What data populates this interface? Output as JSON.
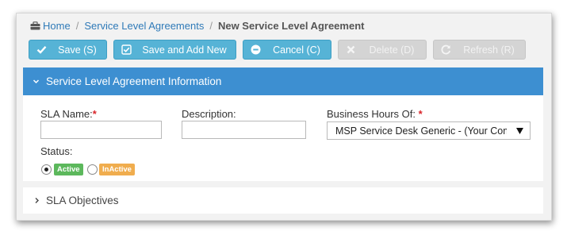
{
  "breadcrumb": {
    "home": "Home",
    "parent": "Service Level Agreements",
    "separator": "/",
    "current": "New Service Level Agreement"
  },
  "toolbar": {
    "save": "Save (S)",
    "save_add_new": "Save and Add New",
    "cancel": "Cancel (C)",
    "delete": "Delete (D)",
    "refresh": "Refresh (R)"
  },
  "panel": {
    "title": "Service Level Agreement Information",
    "sla_name_label": "SLA Name:",
    "required_mark": "*",
    "sla_name_value": "",
    "description_label": "Description:",
    "description_value": "",
    "business_hours_label": "Business Hours Of:",
    "business_hours_value": "MSP Service Desk Generic - (Your Company)",
    "status_label": "Status:",
    "status_active": "Active",
    "status_inactive": "InActive",
    "status_selected": "Active"
  },
  "objectives": {
    "title": "SLA Objectives"
  },
  "colors": {
    "header_blue": "#3d8fd1",
    "button_blue": "#56b3d6",
    "active_green": "#5cb85c",
    "inactive_orange": "#f0ad4e",
    "required_red": "#d9252a"
  },
  "icons": {
    "home": "briefcase-icon",
    "save": "check-icon",
    "save_add_new": "check-square-icon",
    "cancel": "minus-circle-icon",
    "delete": "x-icon",
    "refresh": "refresh-icon",
    "panel_header": "chevron-down-icon",
    "objectives": "chevron-right-icon",
    "select": "caret-down-icon"
  }
}
